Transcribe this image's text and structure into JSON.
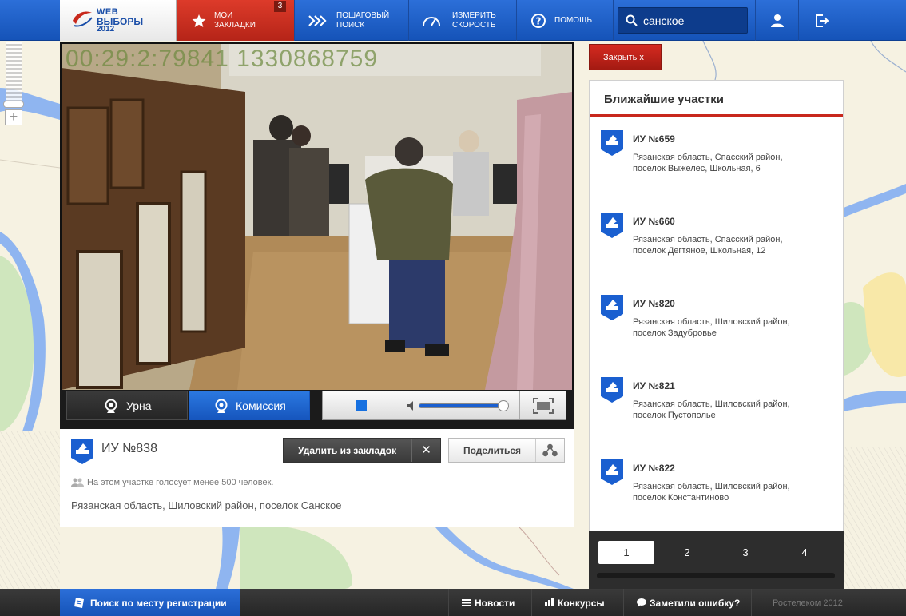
{
  "logo": {
    "line1": "WEB",
    "line2": "ВЫБОРЫ",
    "line3": "2012"
  },
  "nav": {
    "bookmarks": {
      "label1": "МОИ",
      "label2": "ЗАКЛАДКИ",
      "badge": "3"
    },
    "step_search": {
      "label1": "ПОШАГОВЫЙ",
      "label2": "ПОИСК"
    },
    "speed": {
      "label1": "ИЗМЕРИТЬ",
      "label2": "СКОРОСТЬ"
    },
    "help": {
      "label": "ПОМОЩЬ"
    }
  },
  "search": {
    "value": "санское",
    "placeholder": ""
  },
  "video": {
    "timestamp": "00:29:2:79841 1330868759",
    "cams": {
      "urn": "Урна",
      "commission": "Комиссия",
      "active": "commission"
    },
    "volume_fraction": 0.95
  },
  "station": {
    "title": "ИУ №838",
    "delete_label": "Удалить из закладок",
    "share_label": "Поделиться",
    "voters_note": "На этом участке голосует менее 500 человек.",
    "address": "Рязанская область, Шиловский район, поселок Санское"
  },
  "close_label": "Закрыть x",
  "nearest": {
    "title": "Ближайшие участки",
    "items": [
      {
        "name": "ИУ №659",
        "addr1": "Рязанская область, Спасский район,",
        "addr2": "поселок Выжелес, Школьная, 6"
      },
      {
        "name": "ИУ №660",
        "addr1": "Рязанская область, Спасский район,",
        "addr2": "поселок Дегтяное, Школьная, 12"
      },
      {
        "name": "ИУ №820",
        "addr1": "Рязанская область, Шиловский район,",
        "addr2": "поселок Задубровье"
      },
      {
        "name": "ИУ №821",
        "addr1": "Рязанская область, Шиловский район,",
        "addr2": "поселок Пустополье"
      },
      {
        "name": "ИУ №822",
        "addr1": "Рязанская область, Шиловский район,",
        "addr2": "поселок Константиново"
      }
    ],
    "pages": [
      "1",
      "2",
      "3",
      "4"
    ],
    "active_page": "1"
  },
  "bottom": {
    "register_search": "Поиск по месту регистрации",
    "news": "Новости",
    "contests": "Конкурсы",
    "error": "Заметили ошибку?",
    "copyright": "Ростелеком 2012"
  },
  "colors": {
    "brand_blue": "#1a5fd0",
    "accent_red": "#c8281c",
    "map_bg": "#f4f0e0",
    "water": "#8fb5f0"
  }
}
